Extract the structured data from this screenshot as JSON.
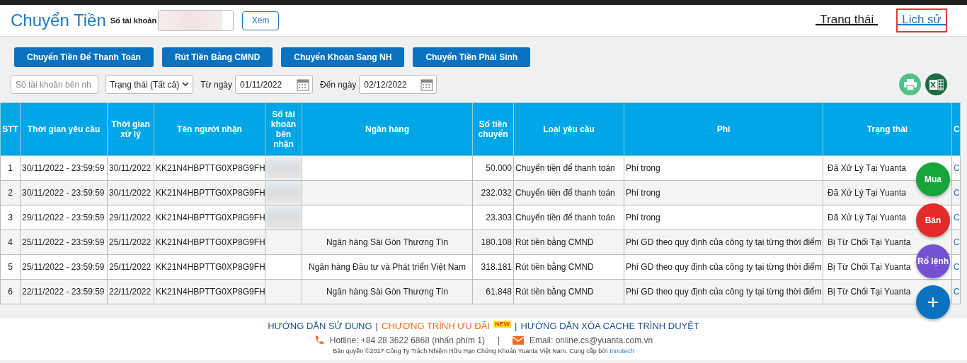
{
  "header": {
    "title": "Chuyển Tiền",
    "account_label": "Số tài khoản",
    "view_button": "Xem"
  },
  "tabs": [
    {
      "label": "Trạng thái",
      "selected": false,
      "highlighted": false
    },
    {
      "label": "Lịch sử",
      "selected": true,
      "highlighted": true
    }
  ],
  "actions": [
    "Chuyển Tiền Để Thanh Toán",
    "Rút Tiền Bằng CMND",
    "Chuyển Khoản Sang NH",
    "Chuyển Tiền Phái Sinh"
  ],
  "filters": {
    "account_placeholder": "Số tài khoản bên nh",
    "status_select": "Trạng thái (Tất cả)",
    "from_label": "Từ ngày",
    "from_date": "01/11/2022",
    "to_label": "Đến ngày",
    "to_date": "02/12/2022"
  },
  "table": {
    "columns": [
      "STT",
      "Thời gian yêu cầu",
      "Thời gian xử lý",
      "Tên người nhận",
      "Số tài khoản bên nhận",
      "Ngân hàng",
      "Số tiền chuyển",
      "Loại yêu cầu",
      "Phí",
      "Trạng thái",
      "C"
    ],
    "rows": [
      {
        "stt": "1",
        "request_time": "30/11/2022 - 23:59:59",
        "process_time": "30/11/2022",
        "recipient": "KK21N4HBPTTG0XP8G9FH",
        "account_blurred": true,
        "amount": "50.000",
        "request_type": "Chuyển tiền để thanh toán",
        "fee": "Phí trong",
        "status": "Đã Xử Lý Tại Yuanta",
        "column_11": "C"
      },
      {
        "stt": "2",
        "request_time": "30/11/2022 - 23:59:59",
        "process_time": "30/11/2022",
        "recipient": "KK21N4HBPTTG0XP8G9FH",
        "account_blurred": true,
        "amount": "232.032",
        "request_type": "Chuyển tiền để thanh toán",
        "fee": "Phí trong",
        "status": "Đã Xử Lý Tại Yuanta",
        "column_11": "C"
      },
      {
        "stt": "3",
        "request_time": "29/11/2022 - 23:59:59",
        "process_time": "29/11/2022",
        "recipient": "KK21N4HBPTTG0XP8G9FH",
        "account_blurred": true,
        "amount": "23.303",
        "request_type": "Chuyển tiền để thanh toán",
        "fee": "Phí trong",
        "status": "Đã Xử Lý Tại Yuanta",
        "column_11": "C"
      },
      {
        "stt": "4",
        "request_time": "25/11/2022 - 23:59:59",
        "process_time": "25/11/2022",
        "recipient": "KK21N4HBPTTG0XP8G9FH",
        "account_blurred": false,
        "bank": "Ngân hàng Sài Gòn Thương Tín",
        "amount": "180.108",
        "request_type": "Rút tiền bằng CMND",
        "fee": "Phí GD theo quy định của công ty tại từng thời điểm",
        "status": "Bị Từ Chối Tại Yuanta",
        "column_11": "C"
      },
      {
        "stt": "5",
        "request_time": "25/11/2022 - 23:59:59",
        "process_time": "25/11/2022",
        "recipient": "KK21N4HBPTTG0XP8G9FH",
        "account_blurred": false,
        "bank": "Ngân hàng Đầu tư và Phát triển Việt Nam",
        "amount": "318.181",
        "request_type": "Rút tiền bằng CMND",
        "fee": "Phí GD theo quy định của công ty tại từng thời điểm",
        "status": "Bị Từ Chối Tại Yuanta",
        "column_11": "C"
      },
      {
        "stt": "6",
        "request_time": "22/11/2022 - 23:59:59",
        "process_time": "22/11/2022",
        "recipient": "KK21N4HBPTTG0XP8G9FH",
        "account_blurred": false,
        "bank": "Ngân hàng Sài Gòn Thương Tín",
        "amount": "61.848",
        "request_type": "Rút tiền bằng CMND",
        "fee": "Phí GD theo quy định của công ty tại từng thời điểm",
        "status": "Bị Từ Chối Tại Yuanta",
        "column_11": "C"
      }
    ]
  },
  "fabs": [
    {
      "label": "Mua",
      "color": "#17a43b"
    },
    {
      "label": "Bán",
      "color": "#e32b2b"
    },
    {
      "label": "Rổ lệnh",
      "color": "#7352d1"
    },
    {
      "label": "+",
      "color": "#0a72c0"
    }
  ],
  "footer": {
    "links": [
      {
        "label": "HƯỚNG DẪN SỬ DỤNG",
        "kind": "plain"
      },
      {
        "label": "CHƯƠNG TRÌNH ƯU ĐÃI",
        "kind": "promo",
        "badge": "NEW"
      },
      {
        "label": "HƯỚNG DẪN XÓA CACHE TRÌNH DUYỆT",
        "kind": "plain"
      }
    ],
    "separator": "|",
    "hotline": "Hotline: +84 28 3622 6868 (nhấn phím 1)",
    "email": "Email: online.cs@yuanta.com.vn",
    "copyright": "Bản quyền ©2017 Công Ty Trách Nhiệm Hữu Hạn Chứng Khoán Yuanta Việt Nam. Cung cấp bởi",
    "provider": "Innotech"
  }
}
